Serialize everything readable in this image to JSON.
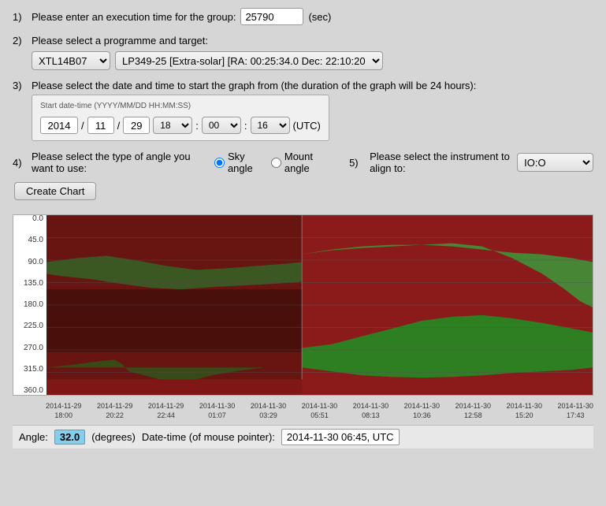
{
  "step1": {
    "num": "1)",
    "label": "Please enter an execution time for the group:",
    "value": "25790",
    "unit": "(sec)"
  },
  "step2": {
    "num": "2)",
    "label": "Please select a programme and target:",
    "programme": {
      "selected": "XTL14B07",
      "options": [
        "XTL14B07"
      ]
    },
    "target": {
      "selected": "LP349-25 [Extra-solar] [RA:  00:25:34.0  Dec:  22:10:20   ]",
      "options": [
        "LP349-25 [Extra-solar] [RA:  00:25:34.0  Dec:  22:10:20   ]"
      ]
    }
  },
  "step3": {
    "num": "3)",
    "label": "Please select the date and time to start the graph from (the duration of the graph will be 24 hours):",
    "hint": "Start date-time (YYYY/MM/DD HH:MM:SS)",
    "year": "2014",
    "month": "11",
    "day": "29",
    "hour": "18",
    "minute": "00",
    "second": "16",
    "timezone": "(UTC)"
  },
  "step4": {
    "num": "4)",
    "label": "Please select the type of angle you want to use:",
    "options": [
      "Sky angle",
      "Mount angle"
    ],
    "selected": "Sky angle"
  },
  "step5": {
    "num": "5)",
    "label": "Please select the instrument to align to:",
    "instrument": {
      "selected": "IO:O",
      "options": [
        "IO:O"
      ]
    }
  },
  "createChart": {
    "label": "Create Chart"
  },
  "chart": {
    "yLabels": [
      "0.0",
      "45.0",
      "90.0",
      "135.0",
      "180.0",
      "225.0",
      "270.0",
      "315.0",
      "360.0"
    ],
    "xLabels": [
      {
        "line1": "2014-11-29",
        "line2": "18:00"
      },
      {
        "line1": "2014-11-29",
        "line2": "20:22"
      },
      {
        "line1": "2014-11-29",
        "line2": "22:44"
      },
      {
        "line1": "2014-11-30",
        "line2": "01:07"
      },
      {
        "line1": "2014-11-30",
        "line2": "03:29"
      },
      {
        "line1": "2014-11-30",
        "line2": "05:51"
      },
      {
        "line1": "2014-11-30",
        "line2": "08:13"
      },
      {
        "line1": "2014-11-30",
        "line2": "10:36"
      },
      {
        "line1": "2014-11-30",
        "line2": "12:58"
      },
      {
        "line1": "2014-11-30",
        "line2": "15:20"
      },
      {
        "line1": "2014-11-30",
        "line2": "17:43"
      }
    ]
  },
  "footer": {
    "angleLabel": "Angle:",
    "angleValue": "32.0",
    "angleUnit": "(degrees)",
    "datetimeLabel": "Date-time (of mouse pointer):",
    "datetimeValue": "2014-11-30 06:45, UTC"
  }
}
